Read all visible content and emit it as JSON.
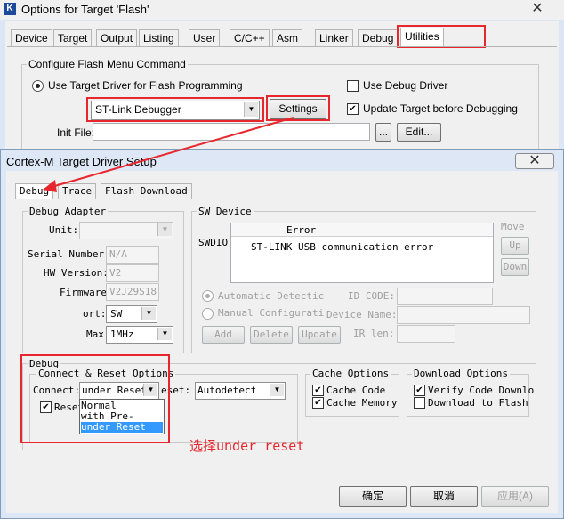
{
  "options_window": {
    "title": "Options for Target 'Flash'",
    "close_label": "✕",
    "tabs": [
      "Device",
      "Target",
      "Output",
      "Listing",
      "User",
      "C/C++",
      "Asm",
      "Linker",
      "Debug",
      "Utilities"
    ],
    "group_label": "Configure Flash Menu Command",
    "use_target_driver_label": "Use Target Driver for Flash Programming",
    "use_debug_driver_label": "Use Debug Driver",
    "driver_value": "ST-Link Debugger",
    "settings_label": "Settings",
    "update_target_label": "Update Target before Debugging",
    "init_file_label": "Init File:",
    "init_file_value": "",
    "browse_label": "...",
    "edit_label": "Edit..."
  },
  "driver_dialog": {
    "title": "Cortex-M Target Driver Setup",
    "close_label": "✕",
    "tabs": [
      "Debug",
      "Trace",
      "Flash Download"
    ],
    "debug_adapter": {
      "label": "Debug Adapter",
      "unit_label": "Unit:",
      "unit_value": "",
      "serial_label": "Serial Number:",
      "serial_value": "N/A",
      "hw_label": "HW Version:",
      "hw_value": "V2",
      "fw_label": "Firmware",
      "fw_value": "V2J29S18",
      "port_label": "ort:",
      "port_value": "SW",
      "max_label": "Max",
      "max_value": "1MHz"
    },
    "sw_device": {
      "label": "SW Device",
      "swdio_label": "SWDIO",
      "error_header": "Error",
      "error_message": "ST-LINK USB communication error",
      "move_label": "Move",
      "up_label": "Up",
      "down_label": "Down",
      "auto_detect_label": "Automatic Detectic",
      "manual_config_label": "Manual Configurati",
      "id_code_label": "ID CODE:",
      "device_name_label": "Device Name:",
      "ir_len_label": "IR len:",
      "add_label": "Add",
      "delete_label": "Delete",
      "update_label": "Update"
    },
    "debug_group": {
      "label": "Debug",
      "connect_reset_label": "Connect & Reset Options",
      "connect_label": "Connect:",
      "connect_value": "under Reset",
      "reset_label": "eset:",
      "reset_value": "Autodetect",
      "reset_after_label": "Reset",
      "dropdown_options": [
        "Normal",
        "with Pre-reset",
        "under Reset"
      ],
      "cache_label": "Cache Options",
      "cache_code_label": "Cache Code",
      "cache_memory_label": "Cache Memory",
      "download_label": "Download Options",
      "verify_label": "Verify Code Downlo",
      "download_flash_label": "Download to Flash"
    },
    "ok_label": "确定",
    "cancel_label": "取消",
    "apply_label": "应用(A)"
  },
  "annotation": {
    "text": "选择under reset",
    "color": "#e8262d"
  },
  "colors": {
    "accent_red": "#e8262d",
    "selected_blue": "#3399ff",
    "dialog_frame": "#dde7f5"
  }
}
